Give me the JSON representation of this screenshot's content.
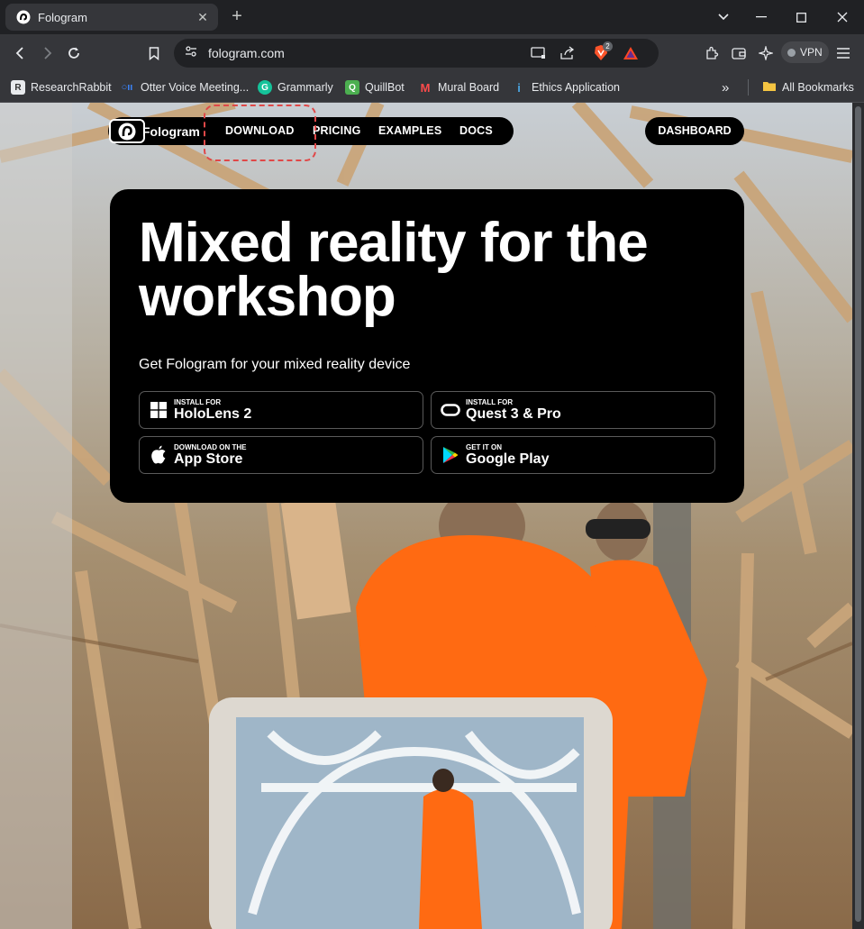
{
  "browser": {
    "tab_title": "Fologram",
    "url": "fologram.com",
    "vpn_label": "VPN",
    "shield_badge": "2",
    "bookmarks": [
      {
        "label": "ResearchRabbit",
        "icon": "researchrabbit-icon"
      },
      {
        "label": "Otter Voice Meeting...",
        "icon": "otter-icon"
      },
      {
        "label": "Grammarly",
        "icon": "grammarly-icon"
      },
      {
        "label": "QuillBot",
        "icon": "quillbot-icon"
      },
      {
        "label": "Mural Board",
        "icon": "mural-icon"
      },
      {
        "label": "Ethics Application",
        "icon": "ethics-icon"
      }
    ],
    "all_bookmarks": "All Bookmarks",
    "overflow": "»"
  },
  "site": {
    "brand": "Fologram",
    "nav": [
      "DOWNLOAD",
      "PRICING",
      "EXAMPLES",
      "DOCS"
    ],
    "dashboard": "DASHBOARD"
  },
  "hero": {
    "title": "Mixed reality for the workshop",
    "subtitle": "Get Fologram for your mixed reality device",
    "stores": [
      {
        "small": "INSTALL FOR",
        "big": "HoloLens 2",
        "icon": "windows-icon"
      },
      {
        "small": "INSTALL FOR",
        "big": "Quest 3 & Pro",
        "icon": "meta-quest-icon"
      },
      {
        "small": "DOWNLOAD ON THE",
        "big": "App Store",
        "icon": "apple-icon"
      },
      {
        "small": "GET IT ON",
        "big": "Google Play",
        "icon": "google-play-icon"
      }
    ]
  },
  "colors": {
    "accent_highlight": "#e04848",
    "safety_orange": "#ff6a12"
  }
}
